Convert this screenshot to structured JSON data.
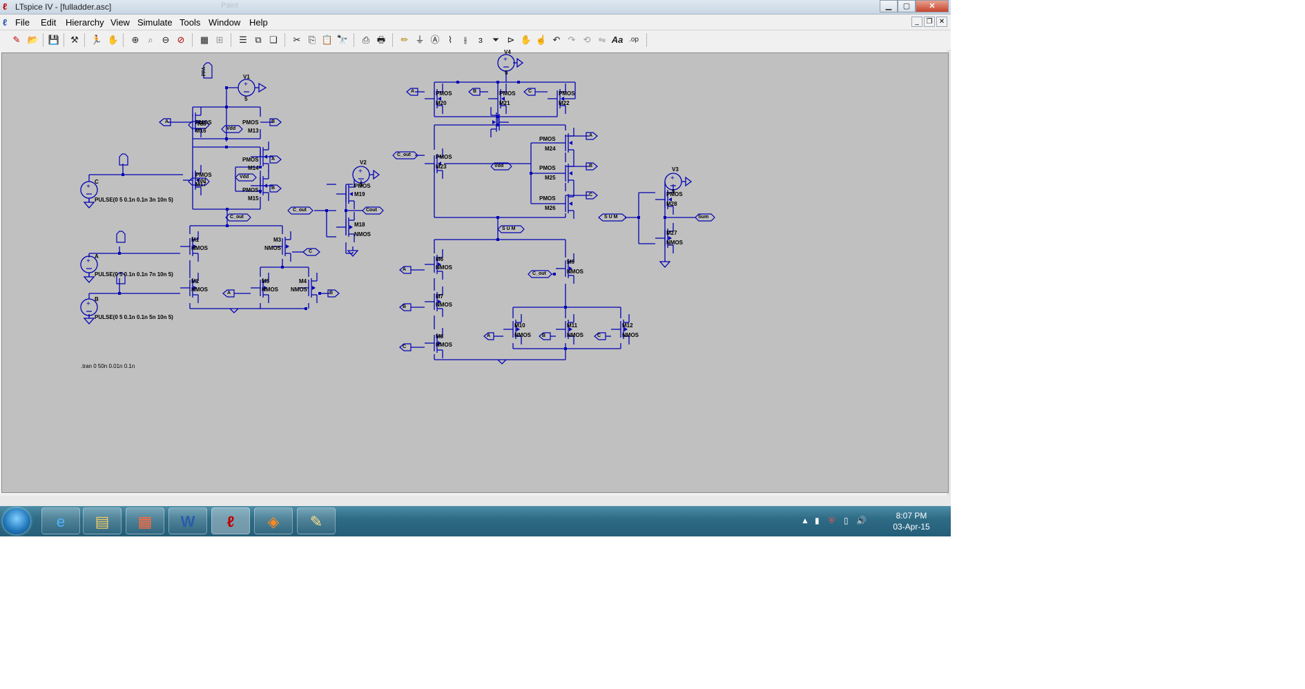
{
  "window": {
    "title": "LTspice IV - [fulladder.asc]",
    "faded_title": "Paint",
    "controls": [
      "minimize",
      "maximize",
      "close"
    ]
  },
  "menu": [
    "File",
    "Edit",
    "Hierarchy",
    "View",
    "Simulate",
    "Tools",
    "Window",
    "Help"
  ],
  "toolbar_icons": [
    "new-schematic-icon",
    "open-icon",
    "save-icon",
    "control-panel-icon",
    "run-icon",
    "halt-icon",
    "zoom-in-icon",
    "zoom-out-icon",
    "zoom-fit-icon",
    "cancel-zoom-icon",
    "autoscale-icon",
    "waveform-icon",
    "tile-horizontal-icon",
    "tile-vertical-icon",
    "cascade-icon",
    "cut-icon",
    "copy-icon",
    "paste-icon",
    "find-icon",
    "print-setup-icon",
    "print-icon",
    "wire-icon",
    "ground-icon",
    "label-net-icon",
    "resistor-icon",
    "capacitor-icon",
    "inductor-icon",
    "diode-icon",
    "component-icon",
    "move-icon",
    "drag-icon",
    "undo-icon",
    "redo-icon",
    "rotate-icon",
    "mirror-icon",
    "text-icon",
    "spice-directive-icon"
  ],
  "schematic": {
    "sources": [
      {
        "name": "V1",
        "value": "5"
      },
      {
        "name": "V2",
        "value": "5"
      },
      {
        "name": "V3",
        "value": "5"
      },
      {
        "name": "V4",
        "value": "5"
      },
      {
        "name": "C",
        "value": "PULSE(0 5 0.1n 0.1n 3n 10n 5)"
      },
      {
        "name": "A",
        "value": "PULSE(0 5 0.1n 0.1n 7n 10n 5)"
      },
      {
        "name": "B",
        "value": "PULSE(0 5 0.1n 0.1n 5n 10n 5)"
      }
    ],
    "directive": ".tran 0 50n 0.01n 0.1n",
    "nets": {
      "vdd": "Vdd",
      "c_out": "C_out",
      "cout": "Cout",
      "s_u_m": "S U M",
      "sum": "Sum",
      "a": "A",
      "b": "B",
      "c": "C"
    },
    "pmos_left": [
      {
        "name": "M16",
        "model": "PMOS"
      },
      {
        "name": "M13",
        "model": "PMOS"
      },
      {
        "name": "M14",
        "model": "PMOS"
      },
      {
        "name": "M17",
        "model": "PMOS"
      },
      {
        "name": "M15",
        "model": "PMOS"
      },
      {
        "name": "M19",
        "model": "PMOS"
      }
    ],
    "nmos_left": [
      {
        "name": "M1",
        "model": "NMOS"
      },
      {
        "name": "M2",
        "model": "NMOS"
      },
      {
        "name": "M3",
        "model": "NMOS"
      },
      {
        "name": "M5",
        "model": "NMOS"
      },
      {
        "name": "M4",
        "model": "NMOS"
      },
      {
        "name": "M18",
        "model": "NMOS"
      }
    ],
    "pmos_right": [
      {
        "name": "M20",
        "model": "PMOS"
      },
      {
        "name": "M21",
        "model": "PMOS"
      },
      {
        "name": "M22",
        "model": "PMOS"
      },
      {
        "name": "M23",
        "model": "PMOS"
      },
      {
        "name": "M24",
        "model": "PMOS"
      },
      {
        "name": "M25",
        "model": "PMOS"
      },
      {
        "name": "M26",
        "model": "PMOS"
      },
      {
        "name": "M28",
        "model": "PMOS"
      }
    ],
    "nmos_right": [
      {
        "name": "M6",
        "model": "NMOS"
      },
      {
        "name": "M7",
        "model": "NMOS"
      },
      {
        "name": "M8",
        "model": "NMOS"
      },
      {
        "name": "M9",
        "model": "NMOS"
      },
      {
        "name": "M10",
        "model": "NMOS"
      },
      {
        "name": "M11",
        "model": "NMOS"
      },
      {
        "name": "M12",
        "model": "NMOS"
      },
      {
        "name": "M27",
        "model": "NMOS"
      }
    ]
  },
  "taskbar": {
    "apps": [
      "start-orb",
      "internet-explorer-icon",
      "file-explorer-icon",
      "start-menu-tiles-icon",
      "word-icon",
      "ltspice-icon",
      "office-picture-icon",
      "paint-icon"
    ],
    "time": "8:07 PM",
    "date": "03-Apr-15"
  },
  "colors": {
    "wire": "#0000b4",
    "canvas": "#c0c0c0",
    "taskbar": "#2f6c86"
  }
}
